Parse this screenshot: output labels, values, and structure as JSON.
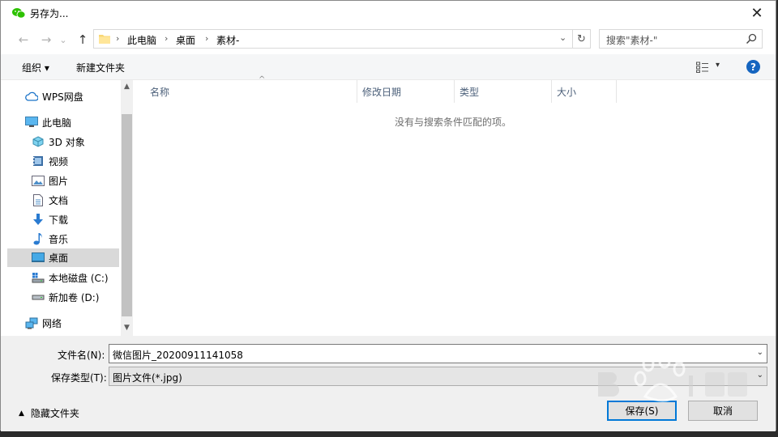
{
  "window": {
    "title": "另存为...",
    "close_glyph": "✕"
  },
  "nav": {
    "back_glyph": "←",
    "forward_glyph": "→",
    "history_glyph": "⌄",
    "up_glyph": "↑",
    "breadcrumb": [
      "此电脑",
      "桌面",
      "素材-"
    ],
    "separator": "›",
    "dropdown_glyph": "⌄",
    "refresh_glyph": "↻",
    "search_placeholder": "搜索\"素材-\""
  },
  "toolbar": {
    "organize_label": "组织 ▾",
    "new_folder_label": "新建文件夹",
    "view_arrow": "▾",
    "help_glyph": "?"
  },
  "sidebar": {
    "items": [
      {
        "label": "WPS网盘",
        "icon": "cloud-icon"
      },
      {
        "label": "此电脑",
        "icon": "computer-icon"
      },
      {
        "label": "3D 对象",
        "icon": "3d-objects-icon"
      },
      {
        "label": "视频",
        "icon": "video-icon"
      },
      {
        "label": "图片",
        "icon": "pictures-icon"
      },
      {
        "label": "文档",
        "icon": "documents-icon"
      },
      {
        "label": "下载",
        "icon": "download-icon"
      },
      {
        "label": "音乐",
        "icon": "music-icon"
      },
      {
        "label": "桌面",
        "icon": "desktop-icon"
      },
      {
        "label": "本地磁盘 (C:)",
        "icon": "local-disk-icon"
      },
      {
        "label": "新加卷 (D:)",
        "icon": "drive-icon"
      },
      {
        "label": "网络",
        "icon": "network-icon"
      }
    ],
    "scroll_up_glyph": "▲",
    "scroll_down_glyph": "▼"
  },
  "files": {
    "columns": [
      "名称",
      "修改日期",
      "类型",
      "大小"
    ],
    "sort_glyph": "^",
    "empty_message": "没有与搜索条件匹配的项。"
  },
  "form": {
    "filename_label": "文件名(N):",
    "filename_value": "微信图片_20200911141058",
    "filetype_label": "保存类型(T):",
    "filetype_value": "图片文件(*.jpg)",
    "dropdown_glyph": "⌄"
  },
  "footer": {
    "hide_folders_label": "隐藏文件夹",
    "hide_glyph": "▲",
    "save_label": "保存(S)",
    "cancel_label": "取消"
  },
  "colors": {
    "selected_bg": "#d9d9d9",
    "accent": "#0078d7",
    "help_bg": "#1565c0",
    "column_text": "#4c607a"
  }
}
